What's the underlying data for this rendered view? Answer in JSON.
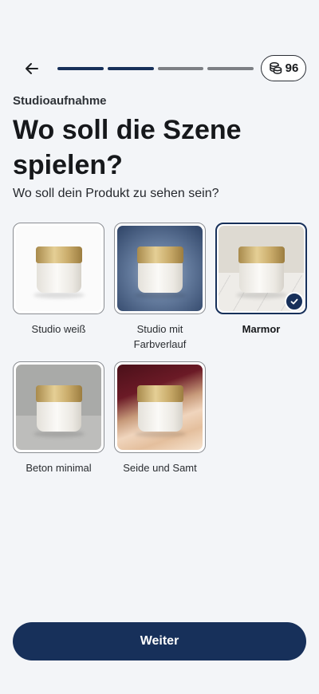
{
  "header": {
    "back_icon": "arrow-left-icon",
    "progress": {
      "total_steps": 4,
      "completed_steps": 2
    },
    "credits": {
      "icon": "coins-icon",
      "value": "96"
    }
  },
  "page": {
    "eyebrow": "Studioaufnahme",
    "title": "Wo soll die Szene spielen?",
    "subtitle": "Wo soll dein Produkt zu sehen sein?"
  },
  "options": [
    {
      "label": "Studio weiß",
      "selected": false
    },
    {
      "label": "Studio mit Farbverlauf",
      "selected": false
    },
    {
      "label": "Marmor",
      "selected": true
    },
    {
      "label": "Beton minimal",
      "selected": false
    },
    {
      "label": "Seide und Samt",
      "selected": false
    }
  ],
  "footer": {
    "continue_label": "Weiter"
  },
  "colors": {
    "accent": "#17305a",
    "background": "#f3f5f8"
  }
}
